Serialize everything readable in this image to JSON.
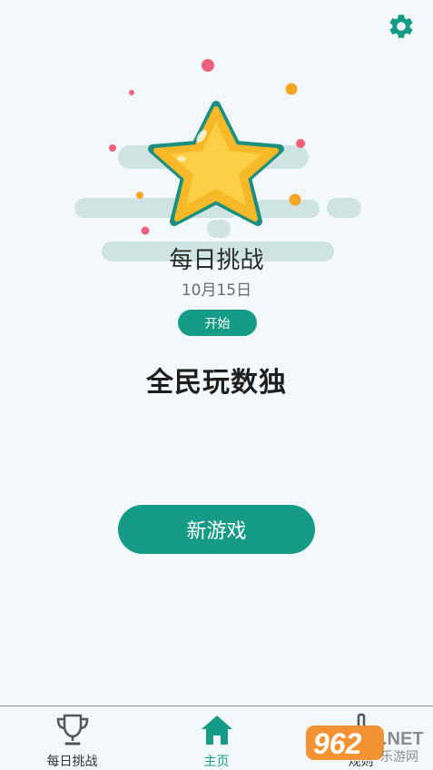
{
  "hero": {
    "title": "每日挑战",
    "date": "10月15日",
    "start_label": "开始"
  },
  "game": {
    "title": "全民玩数独",
    "new_game_label": "新游戏"
  },
  "tabs": [
    {
      "label": "每日挑战",
      "icon": "trophy-icon",
      "active": false
    },
    {
      "label": "主页",
      "icon": "home-icon",
      "active": true
    },
    {
      "label": "规则",
      "icon": "rules-icon",
      "active": false
    }
  ],
  "watermark": {
    "number": "962",
    "suffix": ".NET",
    "subtitle": "乐游网"
  },
  "colors": {
    "accent": "#169b86",
    "background": "#f3f8fc",
    "star": "#f7b928",
    "cloud": "#cfe3e2"
  }
}
